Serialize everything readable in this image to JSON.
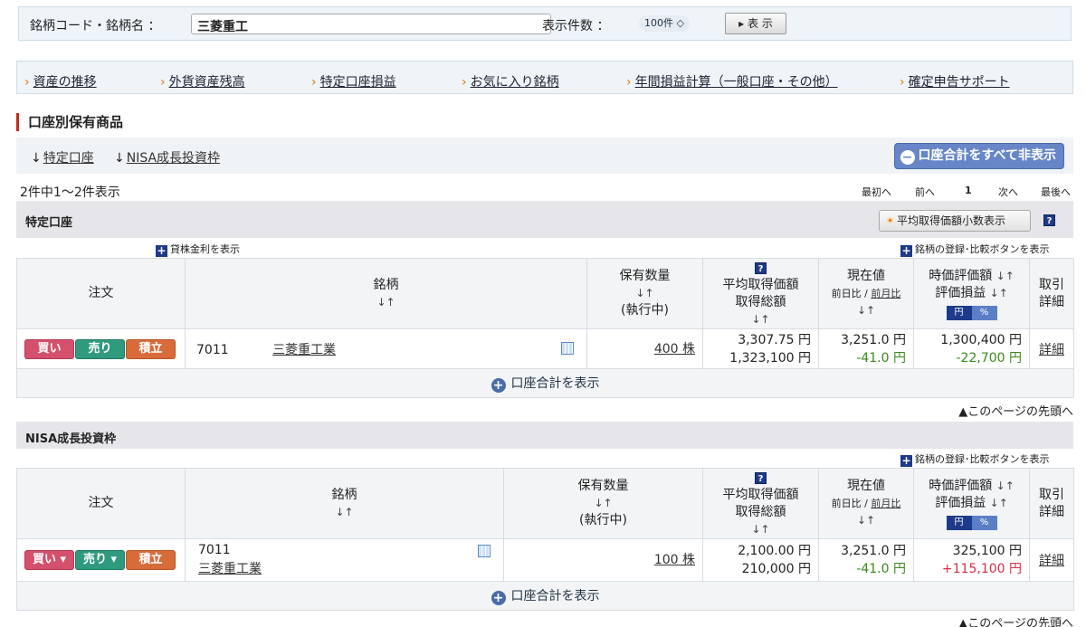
{
  "search": {
    "label": "銘柄コード・銘柄名 ：",
    "value": "三菱重工",
    "count_label": "表示件数 ：",
    "count_value": "100件 ◇",
    "button": "▸ 表 示"
  },
  "nav": [
    "資産の推移",
    "外貨資産残高",
    "特定口座損益",
    "お気に入り銘柄",
    "年間損益計算（一般口座・その他）",
    "確定申告サポート"
  ],
  "section_title": "口座別保有商品",
  "anchors": [
    "特定口座",
    "NISA成長投資枠"
  ],
  "hide_all_button": "口座合計をすべて非表示",
  "count_text": "2件中1〜2件表示",
  "pager": {
    "first": "最初へ",
    "prev": "前へ",
    "page": "1",
    "next": "次へ",
    "last": "最後へ"
  },
  "headers": {
    "order": "注文",
    "stock": "銘柄",
    "qty": "保有数量",
    "qty_sub": "(執行中)",
    "avg": "平均取得価額",
    "total_cost": "取得総額",
    "price": "現在値",
    "day_change": "前日比",
    "month_change": "前月比",
    "value": "時価評価額",
    "pl": "評価損益",
    "yen": "円",
    "pct": "%",
    "detail1": "取引",
    "detail2": "詳細",
    "sort": "↓↑"
  },
  "tokutei": {
    "title": "特定口座",
    "avg_decimal_button": "平均取得価額小数表示",
    "lending_link": "貸株金利を表示",
    "register_link": "銘柄の登録･比較ボタンを表示",
    "row": {
      "buy": "買い",
      "sell": "売り",
      "tsumi": "積立",
      "code": "7011",
      "name": "三菱重工業",
      "qty": "400 株",
      "avg": "3,307.75 円",
      "total": "1,323,100 円",
      "price": "3,251.0 円",
      "change": "-41.0 円",
      "value": "1,300,400 円",
      "pl": "-22,700 円",
      "detail": "詳細"
    },
    "total_toggle": "口座合計を表示"
  },
  "nisa": {
    "title": "NISA成長投資枠",
    "register_link": "銘柄の登録･比較ボタンを表示",
    "row": {
      "buy": "買い ▾",
      "sell": "売り ▾",
      "tsumi": "積立",
      "code": "7011",
      "name": "三菱重工業",
      "qty": "100 株",
      "avg": "2,100.00 円",
      "total": "210,000 円",
      "price": "3,251.0 円",
      "change": "-41.0 円",
      "value": "325,100 円",
      "pl": "+115,100 円",
      "detail": "詳細"
    },
    "total_toggle": "口座合計を表示"
  },
  "page_top": "▲このページの先頭へ",
  "colors": {
    "buy": "#d4506c",
    "sell": "#2f9a7d",
    "tsumi": "#d86b3a",
    "gain": "#d0304a",
    "loss": "#3a8a1a"
  }
}
